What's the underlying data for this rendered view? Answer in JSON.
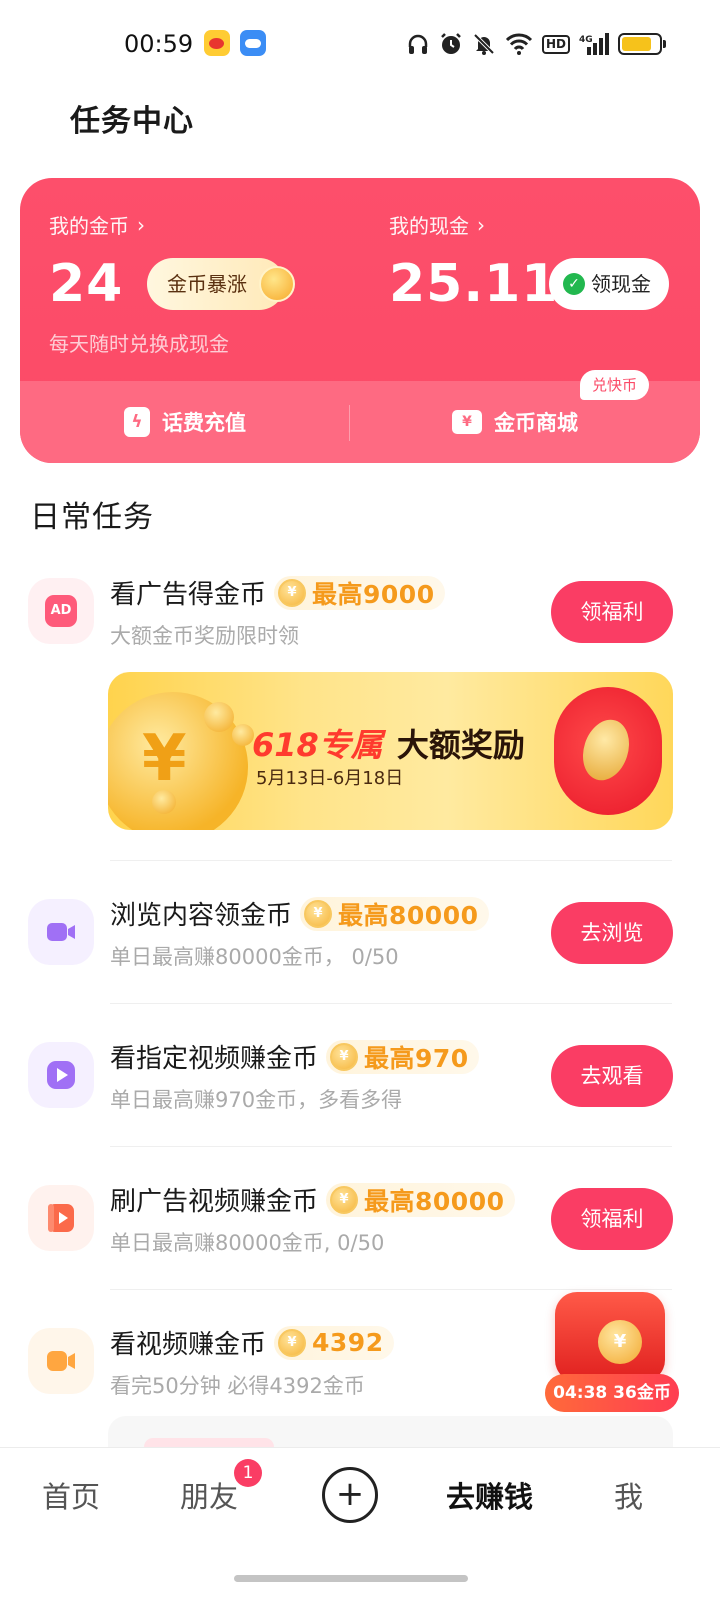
{
  "status_bar": {
    "time": "00:59",
    "network_label": "4G",
    "hd_label": "HD",
    "battery_level": 0.8
  },
  "header": {
    "title": "任务中心"
  },
  "wallet": {
    "coins_label": "我的金币",
    "coins_value": "24",
    "coins_boost_label": "金币暴涨",
    "cash_label": "我的现金",
    "cash_value": "25.11",
    "cash_button_label": "领现金",
    "subtitle": "每天随时兑换成现金",
    "recharge_label": "话费充值",
    "mall_label": "金币商城",
    "mall_badge": "兑快币",
    "chevron": "›"
  },
  "section": {
    "title": "日常任务"
  },
  "tasks": [
    {
      "name": "看广告得金币",
      "reward": "最高9000",
      "desc": "大额金币奖励限时领",
      "button": "领福利",
      "icon": "ad-icon",
      "icon_color": "#fe5a7a",
      "icon_bg": "#fff0f2"
    },
    {
      "name": "浏览内容领金币",
      "reward": "最高80000",
      "desc": "单日最高赚80000金币， 0/50",
      "button": "去浏览",
      "icon": "video-camera-icon",
      "icon_color": "#a070f5",
      "icon_bg": "#f5f0ff"
    },
    {
      "name": "看指定视频赚金币",
      "reward": "最高970",
      "desc": "单日最高赚970金币，多看多得",
      "button": "去观看",
      "icon": "play-icon",
      "icon_color": "#a070f5",
      "icon_bg": "#f5f0ff"
    },
    {
      "name": "刷广告视频赚金币",
      "reward": "最高80000",
      "desc": "单日最高赚80000金币, 0/50",
      "button": "领福利",
      "icon": "video-ad-icon",
      "icon_color": "#fb6a4a",
      "icon_bg": "#fff2ee"
    },
    {
      "name": "看视频赚金币",
      "reward": "4392",
      "desc": "看完50分钟 必得4392金币",
      "button": "",
      "icon": "video-icon",
      "icon_color": "#ffa640",
      "icon_bg": "#fff6ea"
    }
  ],
  "banner": {
    "title_highlight": "618专属",
    "title": "大额奖励",
    "date": "5月13日-6月18日"
  },
  "float_packet": {
    "timer": "04:38 36金币",
    "seal": "¥"
  },
  "coin_symbol": "¥",
  "bottom_nav": {
    "home": "首页",
    "friends": "朋友",
    "friends_badge": "1",
    "plus": "+",
    "earn": "去赚钱",
    "me": "我"
  },
  "colors": {
    "accent": "#fa3d64",
    "wallet_bg": "#fb4a67",
    "reward_text": "#f59a1c"
  }
}
